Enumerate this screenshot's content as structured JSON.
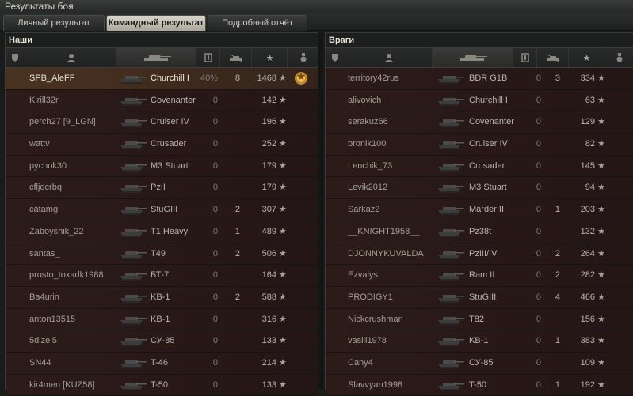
{
  "window": {
    "title": "Результаты боя"
  },
  "tabs": [
    {
      "label": "Личный результат"
    },
    {
      "label": "Командный результат"
    },
    {
      "label": "Подробный отчёт"
    }
  ],
  "allies": {
    "title": "Наши",
    "rows": [
      {
        "player": "SPB_AleFF",
        "tank": "Churchill I",
        "pct": "40%",
        "kills": "8",
        "xp": "1468",
        "self": true,
        "medal": true
      },
      {
        "player": "Kirill32r",
        "tank": "Covenanter",
        "pct": "0",
        "kills": "",
        "xp": "142"
      },
      {
        "player": "perch27 [9_LGN]",
        "tank": "Cruiser IV",
        "pct": "0",
        "kills": "",
        "xp": "196"
      },
      {
        "player": "wattv",
        "tank": "Crusader",
        "pct": "0",
        "kills": "",
        "xp": "252"
      },
      {
        "player": "pychok30",
        "tank": "M3 Stuart",
        "pct": "0",
        "kills": "",
        "xp": "179"
      },
      {
        "player": "cfljdcrbq",
        "tank": "PzII",
        "pct": "0",
        "kills": "",
        "xp": "179"
      },
      {
        "player": "catamg",
        "tank": "StuGIII",
        "pct": "0",
        "kills": "2",
        "xp": "307"
      },
      {
        "player": "Zaboyshik_22",
        "tank": "T1 Heavy",
        "pct": "0",
        "kills": "1",
        "xp": "489"
      },
      {
        "player": "santas_",
        "tank": "T49",
        "pct": "0",
        "kills": "2",
        "xp": "506"
      },
      {
        "player": "prosto_toxadk1988",
        "tank": "БТ-7",
        "pct": "0",
        "kills": "",
        "xp": "164"
      },
      {
        "player": "Ba4urin",
        "tank": "KB-1",
        "pct": "0",
        "kills": "2",
        "xp": "588"
      },
      {
        "player": "anton13515",
        "tank": "KB-1",
        "pct": "0",
        "kills": "",
        "xp": "316"
      },
      {
        "player": "5dizel5",
        "tank": "СУ-85",
        "pct": "0",
        "kills": "",
        "xp": "133"
      },
      {
        "player": "SN44",
        "tank": "T-46",
        "pct": "0",
        "kills": "",
        "xp": "214"
      },
      {
        "player": "kir4men [KUZ58]",
        "tank": "T-50",
        "pct": "0",
        "kills": "",
        "xp": "133"
      }
    ]
  },
  "enemies": {
    "title": "Враги",
    "rows": [
      {
        "player": "territory42rus",
        "tank": "BDR G1B",
        "pct": "0",
        "kills": "3",
        "xp": "334"
      },
      {
        "player": "alivovich",
        "tank": "Churchill I",
        "pct": "0",
        "kills": "",
        "xp": "63"
      },
      {
        "player": "serakuz66",
        "tank": "Covenanter",
        "pct": "0",
        "kills": "",
        "xp": "129"
      },
      {
        "player": "bronik100",
        "tank": "Cruiser IV",
        "pct": "0",
        "kills": "",
        "xp": "82"
      },
      {
        "player": "Lenchik_73",
        "tank": "Crusader",
        "pct": "0",
        "kills": "",
        "xp": "145"
      },
      {
        "player": "Levik2012",
        "tank": "M3 Stuart",
        "pct": "0",
        "kills": "",
        "xp": "94"
      },
      {
        "player": "Sarkaz2",
        "tank": "Marder II",
        "pct": "0",
        "kills": "1",
        "xp": "203"
      },
      {
        "player": "__KNIGHT1958__",
        "tank": "Pz38t",
        "pct": "0",
        "kills": "",
        "xp": "132"
      },
      {
        "player": "DJONNYKUVALDA",
        "tank": "PzIII/IV",
        "pct": "0",
        "kills": "2",
        "xp": "264"
      },
      {
        "player": "Ezvalys",
        "tank": "Ram II",
        "pct": "0",
        "kills": "2",
        "xp": "282"
      },
      {
        "player": "PRODIGY1",
        "tank": "StuGIII",
        "pct": "0",
        "kills": "4",
        "xp": "466"
      },
      {
        "player": "Nickcrushman",
        "tank": "T82",
        "pct": "0",
        "kills": "",
        "xp": "156"
      },
      {
        "player": "vasili1978",
        "tank": "KB-1",
        "pct": "0",
        "kills": "1",
        "xp": "383"
      },
      {
        "player": "Cany4",
        "tank": "СУ-85",
        "pct": "0",
        "kills": "",
        "xp": "109"
      },
      {
        "player": "Slavvyan1998",
        "tank": "T-50",
        "pct": "0",
        "kills": "1",
        "xp": "192"
      }
    ]
  },
  "icons": {
    "platoon": "platoon-icon",
    "player": "player-icon",
    "tank": "tank-icon",
    "damage": "damage-shield-icon",
    "kills": "kills-icon",
    "xp": "xp-star-icon",
    "medal": "medal-icon"
  },
  "colors": {
    "accent": "#d9d6ca",
    "row_ally_self": "#4a3221",
    "row": "#2c1b19"
  }
}
